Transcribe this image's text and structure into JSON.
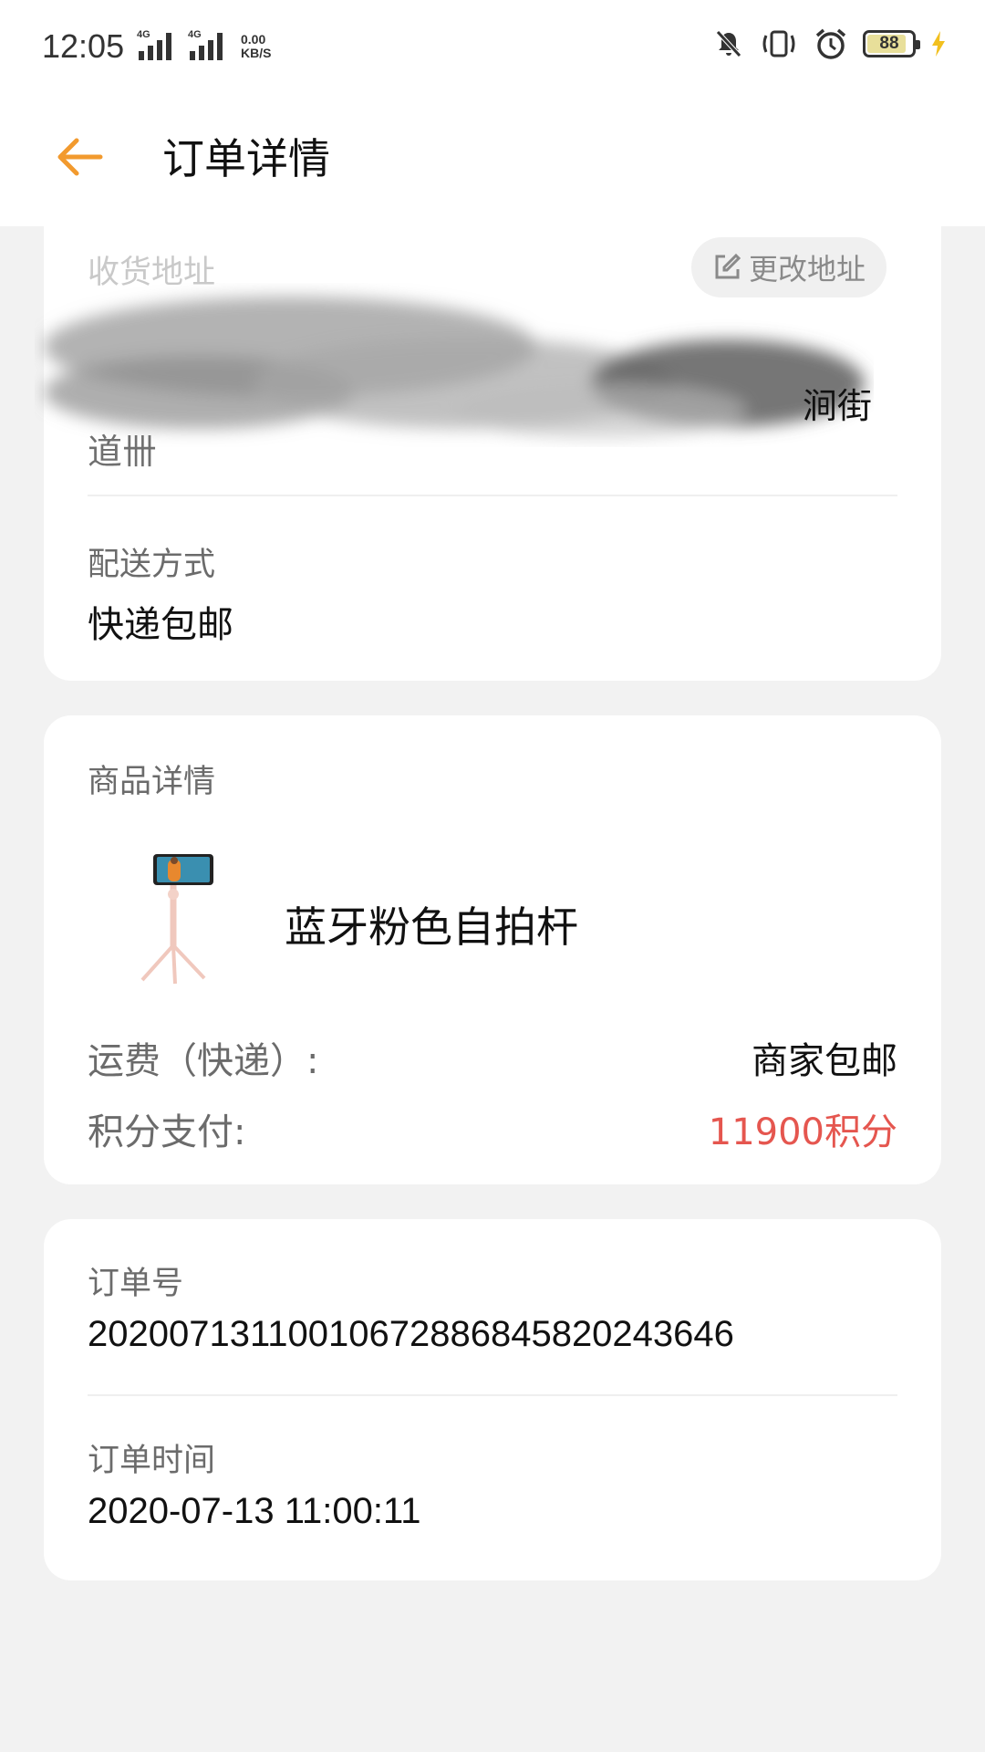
{
  "status_bar": {
    "time": "12:05",
    "network_1": "4G",
    "network_2": "4G",
    "speed_value": "0.00",
    "speed_unit": "KB/S",
    "battery": "88",
    "battery_level_percent": 88,
    "icons": [
      "mute-icon",
      "vibrate-icon",
      "alarm-icon",
      "battery-icon",
      "charging-icon"
    ]
  },
  "header": {
    "title": "订单详情",
    "back_icon": "arrow-left-icon",
    "accent_color": "#f29a2e"
  },
  "address_card": {
    "label": "收货地址",
    "change_button": "更改地址",
    "change_icon": "edit-icon",
    "fragment_end": "涧街",
    "fragment_start": "道卌",
    "delivery_label": "配送方式",
    "delivery_value": "快递包邮"
  },
  "goods_card": {
    "label": "商品详情",
    "product_name": "蓝牙粉色自拍杆",
    "shipping_label": "运费（快递）:",
    "shipping_value": "商家包邮",
    "points_label": "积分支付:",
    "points_value": "11900积分",
    "points_color": "#e5564f"
  },
  "order_card": {
    "order_no_label": "订单号",
    "order_no": "202007131100106728868458202436 46",
    "order_time_label": "订单时间",
    "order_time": "2020-07-13 11:00:11"
  }
}
